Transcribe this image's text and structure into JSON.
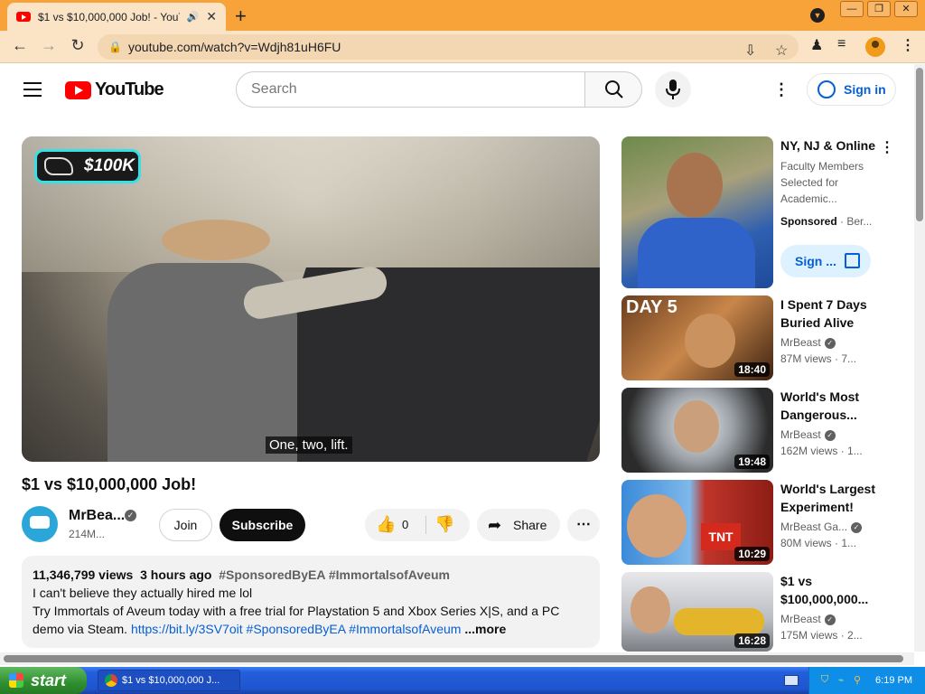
{
  "browser": {
    "tab_title": "$1 vs $10,000,000 Job! - YouT",
    "url": "youtube.com/watch?v=Wdjh81uH6FU"
  },
  "youtube": {
    "logo_text": "YouTube",
    "search_placeholder": "Search",
    "signin_label": "Sign in"
  },
  "player": {
    "badge_text": "$100K",
    "caption": "One, two, lift."
  },
  "video": {
    "title": "$1 vs $10,000,000 Job!",
    "channel_name": "MrBea...",
    "subscribers": "214M...",
    "join_label": "Join",
    "subscribe_label": "Subscribe",
    "like_count": "0",
    "share_label": "Share",
    "views": "11,346,799 views",
    "age": "3 hours ago",
    "hashtags": "#SponsoredByEA #ImmortalsofAveum",
    "desc_line1": "I can't believe they actually hired me lol",
    "desc_line2": "Try Immortals of Aveum today with a free trial for Playstation 5 and Xbox Series X|S, and a PC",
    "desc_line3_text": "demo via Steam. ",
    "desc_link": "https://bit.ly/3SV7oit",
    "desc_tags2": " #SponsoredByEA #ImmortalsofAveum",
    "more_label": "...more"
  },
  "sidebar": {
    "ad": {
      "title": "NY, NJ & Online",
      "body": "Faculty Members Selected for Academic...",
      "sponsored": "Sponsored",
      "advertiser": "· Ber...",
      "button": "Sign ..."
    },
    "items": [
      {
        "title": "I Spent 7 Days Buried Alive",
        "channel": "MrBeast",
        "meta": "87M views · 7...",
        "duration": "18:40",
        "thumb_text": "DAY 5"
      },
      {
        "title": "World's Most Dangerous...",
        "channel": "MrBeast",
        "meta": "162M views · 1...",
        "duration": "19:48"
      },
      {
        "title": "World's Largest Experiment!",
        "channel": "MrBeast Ga...",
        "meta": "80M views · 1...",
        "duration": "10:29",
        "thumb_text": "TNT"
      },
      {
        "title": "$1 vs $100,000,000...",
        "channel": "MrBeast",
        "meta": "175M views · 2...",
        "duration": "16:28"
      }
    ]
  },
  "taskbar": {
    "start_label": "start",
    "task_item": "$1 vs $10,000,000 J...",
    "clock": "6:19 PM"
  },
  "colors": {
    "chrome_frame": "#f7a33a",
    "youtube_red": "#ff0000",
    "link_blue": "#065fd4",
    "xp_taskbar": "#245edb"
  }
}
